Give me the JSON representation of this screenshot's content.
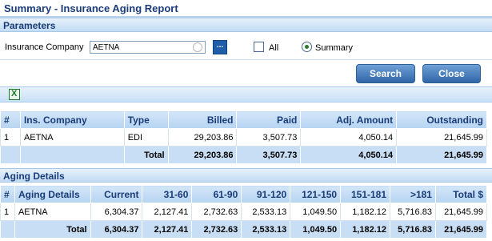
{
  "title": "Summary - Insurance Aging Report",
  "parameters": {
    "header": "Parameters",
    "company_label": "Insurance Company",
    "company_value": "AETNA",
    "browse_label": "...",
    "all_label": "All",
    "summary_label": "Summary",
    "all_checked": false,
    "summary_selected": true
  },
  "buttons": {
    "search": "Search",
    "close": "Close"
  },
  "summary_table": {
    "columns": [
      "#",
      "Ins. Company",
      "Type",
      "Billed",
      "Paid",
      "Adj. Amount",
      "Outstanding"
    ],
    "rows": [
      {
        "num": "1",
        "company": "AETNA",
        "type": "EDI",
        "billed": "29,203.86",
        "paid": "3,507.73",
        "adj": "4,050.14",
        "outstanding": "21,645.99"
      }
    ],
    "total": {
      "label": "Total",
      "billed": "29,203.86",
      "paid": "3,507.73",
      "adj": "4,050.14",
      "outstanding": "21,645.99"
    }
  },
  "aging": {
    "header": "Aging Details",
    "columns": [
      "#",
      "Aging Details",
      "Current",
      "31-60",
      "61-90",
      "91-120",
      "121-150",
      "151-181",
      ">181",
      "Total $"
    ],
    "rows": [
      {
        "num": "1",
        "name": "AETNA",
        "current": "6,304.37",
        "c31": "2,127.41",
        "c61": "2,732.63",
        "c91": "2,533.13",
        "c121": "1,049.50",
        "c151": "1,182.12",
        "c181": "5,716.83",
        "total": "21,645.99"
      }
    ],
    "total": {
      "label": "Total",
      "current": "6,304.37",
      "c31": "2,127.41",
      "c61": "2,732.63",
      "c91": "2,533.13",
      "c121": "1,049.50",
      "c151": "1,182.12",
      "c181": "5,716.83",
      "total": "21,645.99"
    }
  },
  "colors": {
    "header_text": "#1a3c78",
    "button": "#2f66a8",
    "total_row": "#c8def4"
  }
}
